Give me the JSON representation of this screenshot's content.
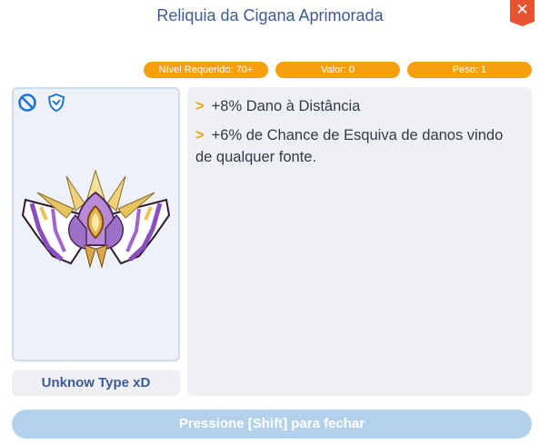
{
  "window": {
    "title": "Reliquia da Cigana Aprimorada",
    "close_label": "✕"
  },
  "stats": {
    "required_level": "Nível Requerido: 70+",
    "value": "Valor: 0",
    "weight": "Peso: 1"
  },
  "item": {
    "type": "Unknow Type xD",
    "icons": [
      "no-entry-icon",
      "shield-icon"
    ],
    "image": "winged-relic-emblem"
  },
  "description": {
    "lines": [
      {
        "marker": ">",
        "text": "+8% Dano à Distância"
      },
      {
        "marker": ">",
        "text": "+6% de Chance de Esquiva de danos vindo de qualquer fonte."
      }
    ]
  },
  "footer": {
    "close_hint": "Pressione [Shift] para fechar"
  },
  "colors": {
    "accent": "#f5a00f",
    "title": "#3e5a96",
    "close": "#e8542f",
    "footer": "#b4d1ec"
  }
}
